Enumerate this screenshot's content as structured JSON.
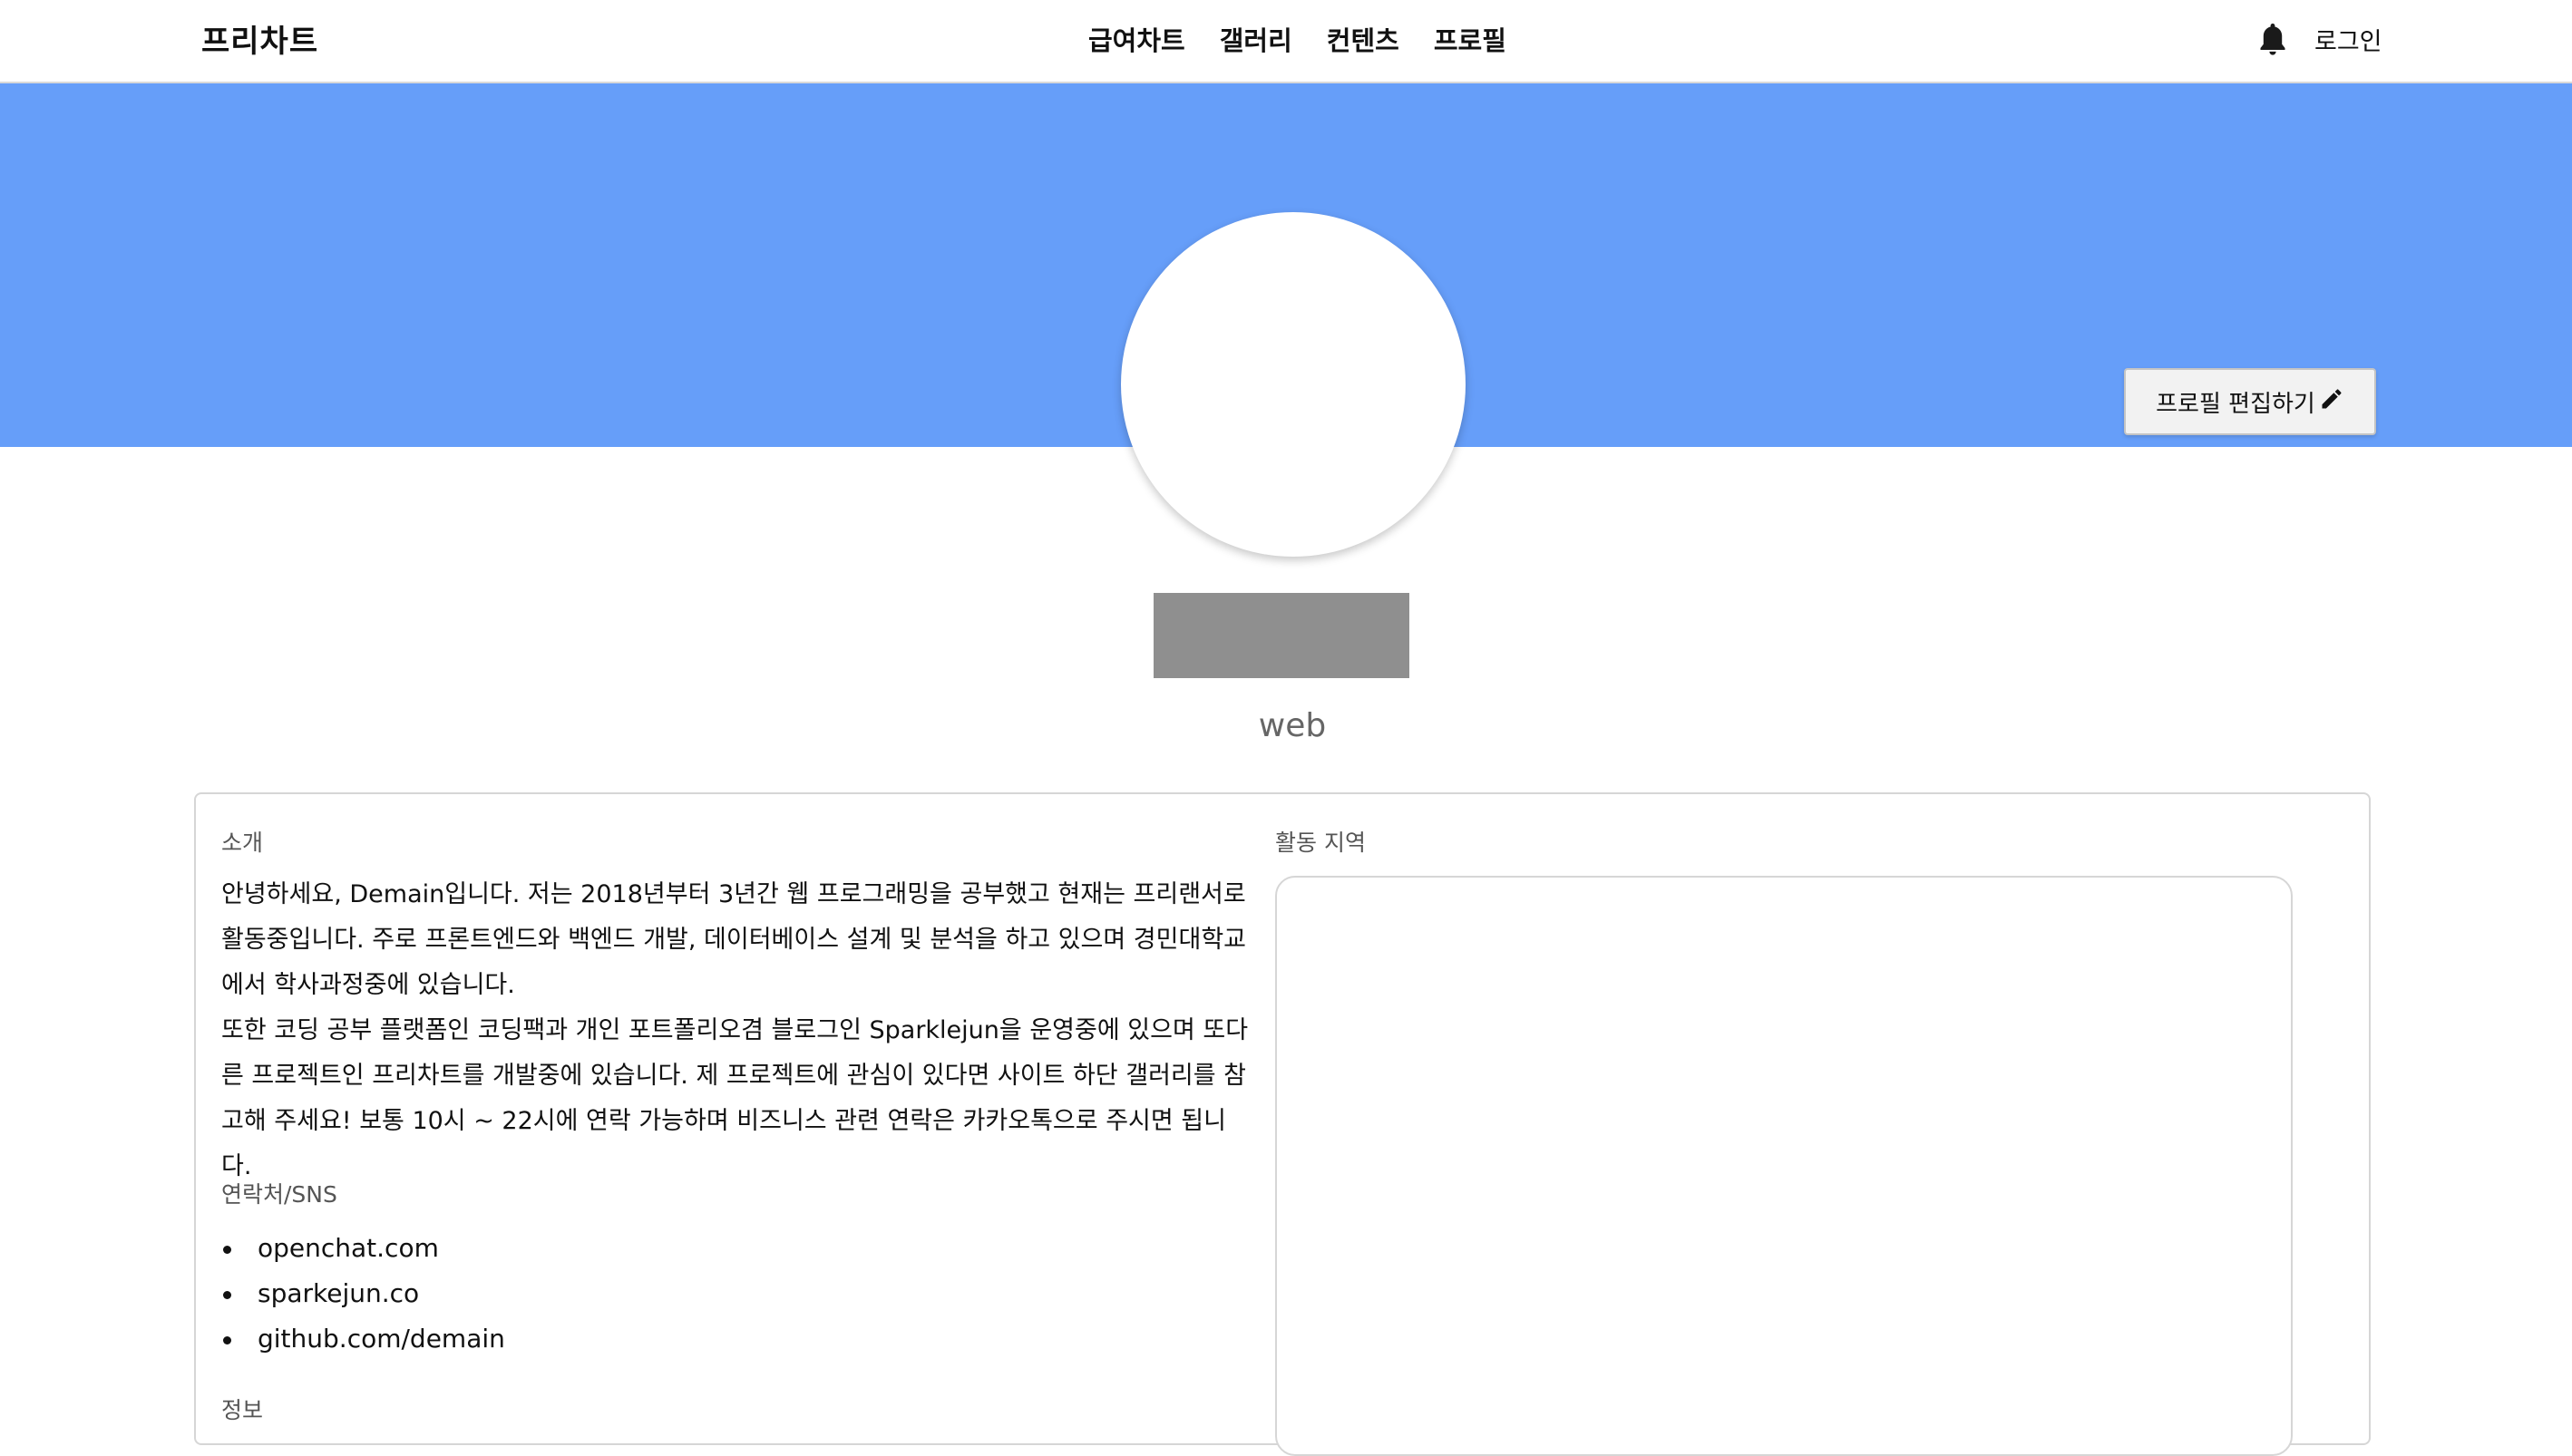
{
  "nav": {
    "brand": "프리차트",
    "links": [
      "급여차트",
      "갤러리",
      "컨텐츠",
      "프로필"
    ],
    "login": "로그인",
    "bell_icon": "bell-icon"
  },
  "banner": {
    "color": "#669ef9",
    "edit_button_label": "프로필 편집하기",
    "edit_icon": "pencil-icon"
  },
  "profile": {
    "role": "web"
  },
  "sections": {
    "intro_label": "소개",
    "intro_paragraphs": [
      "안녕하세요, Demain입니다. 저는 2018년부터 3년간 웹 프로그래밍을 공부했고 현재는 프리랜서로 활동중입니다. 주로 프론트엔드와 백엔드 개발, 데이터베이스 설계 및 분석을 하고 있으며 경민대학교에서 학사과정중에 있습니다.",
      "또한 코딩 공부 플랫폼인 코딩팩과 개인 포트폴리오겸 블로그인 Sparklejun을 운영중에 있으며 또다른 프로젝트인 프리차트를 개발중에 있습니다. 제 프로젝트에 관심이 있다면 사이트 하단 갤러리를 참고해 주세요! 보통 10시 ~ 22시에 연락 가능하며 비즈니스 관련 연락은 카카오톡으로 주시면 됩니다."
    ],
    "contact_label": "연락처/SNS",
    "contacts": [
      "openchat.com",
      "sparkejun.co",
      "github.com/demain"
    ],
    "info_label": "정보",
    "region_label": "활동 지역"
  }
}
